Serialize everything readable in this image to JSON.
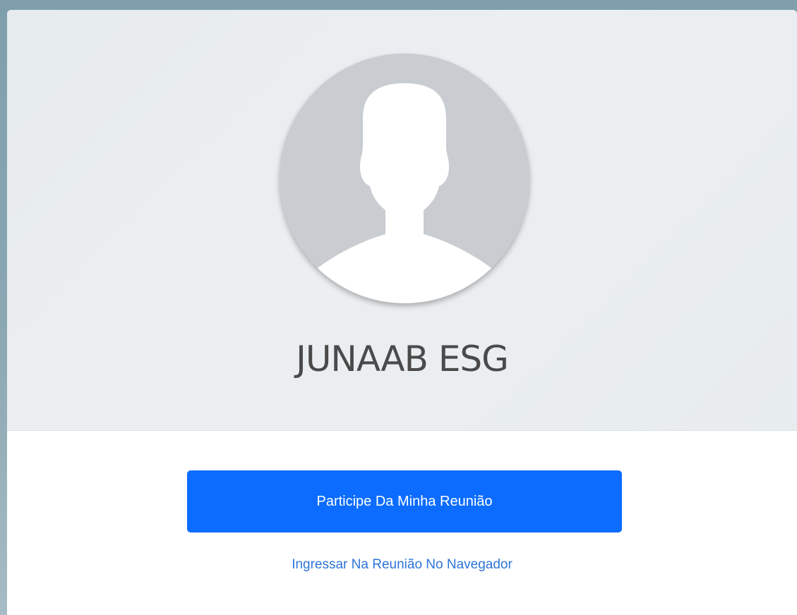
{
  "profile": {
    "name": "JUNAAB ESG",
    "avatar_icon": "person-silhouette-icon"
  },
  "actions": {
    "join_button_label": "Participe Da Minha Reunião",
    "browser_link_label": "Ingressar Na Reunião No Navegador"
  },
  "colors": {
    "primary": "#0b6cff",
    "link": "#2d74d8",
    "hero_background": "#e8ecef",
    "avatar_background": "#c9cdd2"
  }
}
